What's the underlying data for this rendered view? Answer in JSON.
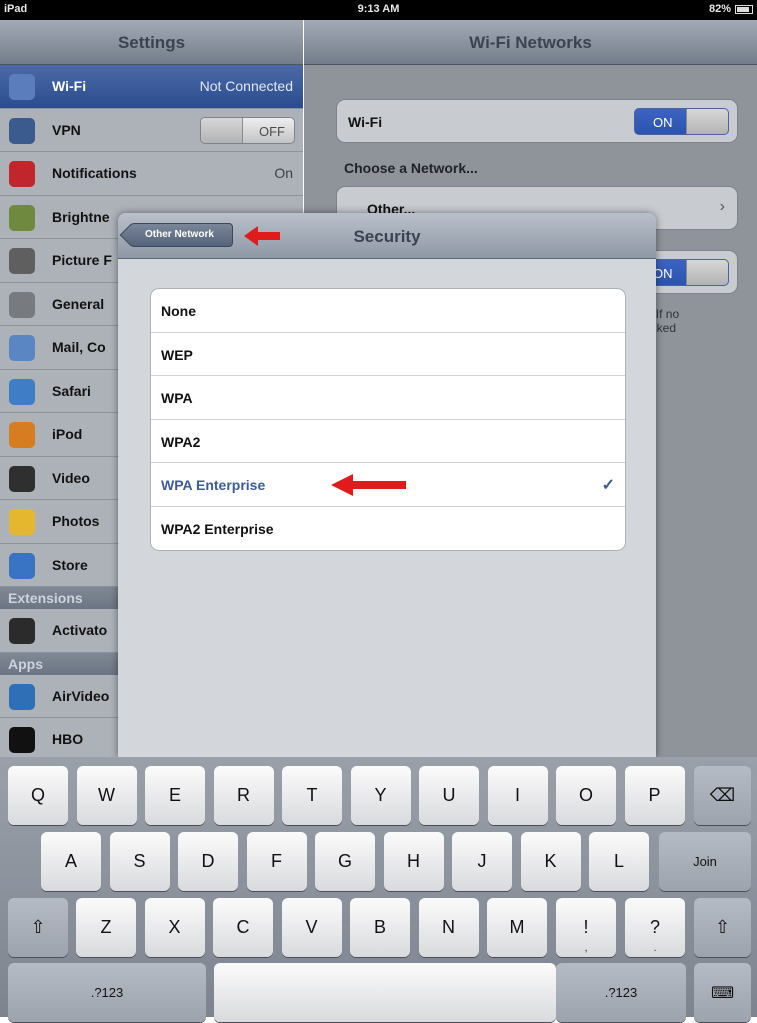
{
  "status_bar": {
    "device": "iPad",
    "time": "9:13 AM",
    "battery": "82%"
  },
  "master": {
    "title": "Settings",
    "rows": [
      {
        "label": "Wi-Fi",
        "value": "Not Connected",
        "icon": "wifi-icon",
        "color": "#5c7dbb",
        "selected": true
      },
      {
        "label": "VPN",
        "switch": "OFF",
        "icon": "vpn-icon",
        "color": "#3b5a8e"
      },
      {
        "label": "Notifications",
        "value": "On",
        "icon": "notifications-icon",
        "color": "#c0262c"
      },
      {
        "label": "Brightne",
        "icon": "brightness-icon",
        "color": "#6f8a3f"
      },
      {
        "label": "Picture F",
        "icon": "picture-frame-icon",
        "color": "#5f5f5f"
      },
      {
        "label": "General",
        "icon": "gear-icon",
        "color": "#777b80"
      },
      {
        "label": "Mail, Co",
        "icon": "mail-icon",
        "color": "#5a86c4"
      },
      {
        "label": "Safari",
        "icon": "safari-icon",
        "color": "#3f7ec6"
      },
      {
        "label": "iPod",
        "icon": "ipod-icon",
        "color": "#d67d22"
      },
      {
        "label": "Video",
        "icon": "video-icon",
        "color": "#2f2f2f"
      },
      {
        "label": "Photos",
        "icon": "photos-icon",
        "color": "#e4b72e"
      },
      {
        "label": "Store",
        "icon": "store-icon",
        "color": "#3973c4"
      }
    ],
    "section_extensions": "Extensions",
    "ext_rows": [
      {
        "label": "Activato",
        "icon": "activator-icon",
        "color": "#2b2b2b"
      }
    ],
    "section_apps": "Apps",
    "app_rows": [
      {
        "label": "AirVideo",
        "icon": "airvideo-icon",
        "color": "#2e6fb5"
      },
      {
        "label": "HBO",
        "icon": "hbo-icon",
        "color": "#111111"
      }
    ]
  },
  "detail": {
    "title": "Wi-Fi Networks",
    "wifi_label": "Wi-Fi",
    "wifi_switch": "ON",
    "choose_label": "Choose a Network...",
    "other_label": "Other...",
    "ask_switch": "ON",
    "hint_line1": "y.  If no",
    "hint_line2": "asked"
  },
  "modal": {
    "title": "Security",
    "back_label": "Other Network",
    "options": [
      {
        "label": "None"
      },
      {
        "label": "WEP"
      },
      {
        "label": "WPA"
      },
      {
        "label": "WPA2"
      },
      {
        "label": "WPA Enterprise",
        "selected": true,
        "check": "✓"
      },
      {
        "label": "WPA2 Enterprise"
      }
    ]
  },
  "keyboard": {
    "row1": [
      "Q",
      "W",
      "E",
      "R",
      "T",
      "Y",
      "U",
      "I",
      "O",
      "P"
    ],
    "row2": [
      "A",
      "S",
      "D",
      "F",
      "G",
      "H",
      "J",
      "K",
      "L"
    ],
    "row3": [
      "Z",
      "X",
      "C",
      "V",
      "B",
      "N",
      "M"
    ],
    "excl": "!",
    "excl_sub": ",",
    "quest": "?",
    "quest_sub": ".",
    "join": "Join",
    "num_left": ".?123",
    "num_right": ".?123",
    "backspace_icon": "backspace-icon",
    "shift_icon": "shift-icon",
    "hide_keyboard_icon": "hide-keyboard-icon"
  },
  "annotation_color": "#e01b1b"
}
